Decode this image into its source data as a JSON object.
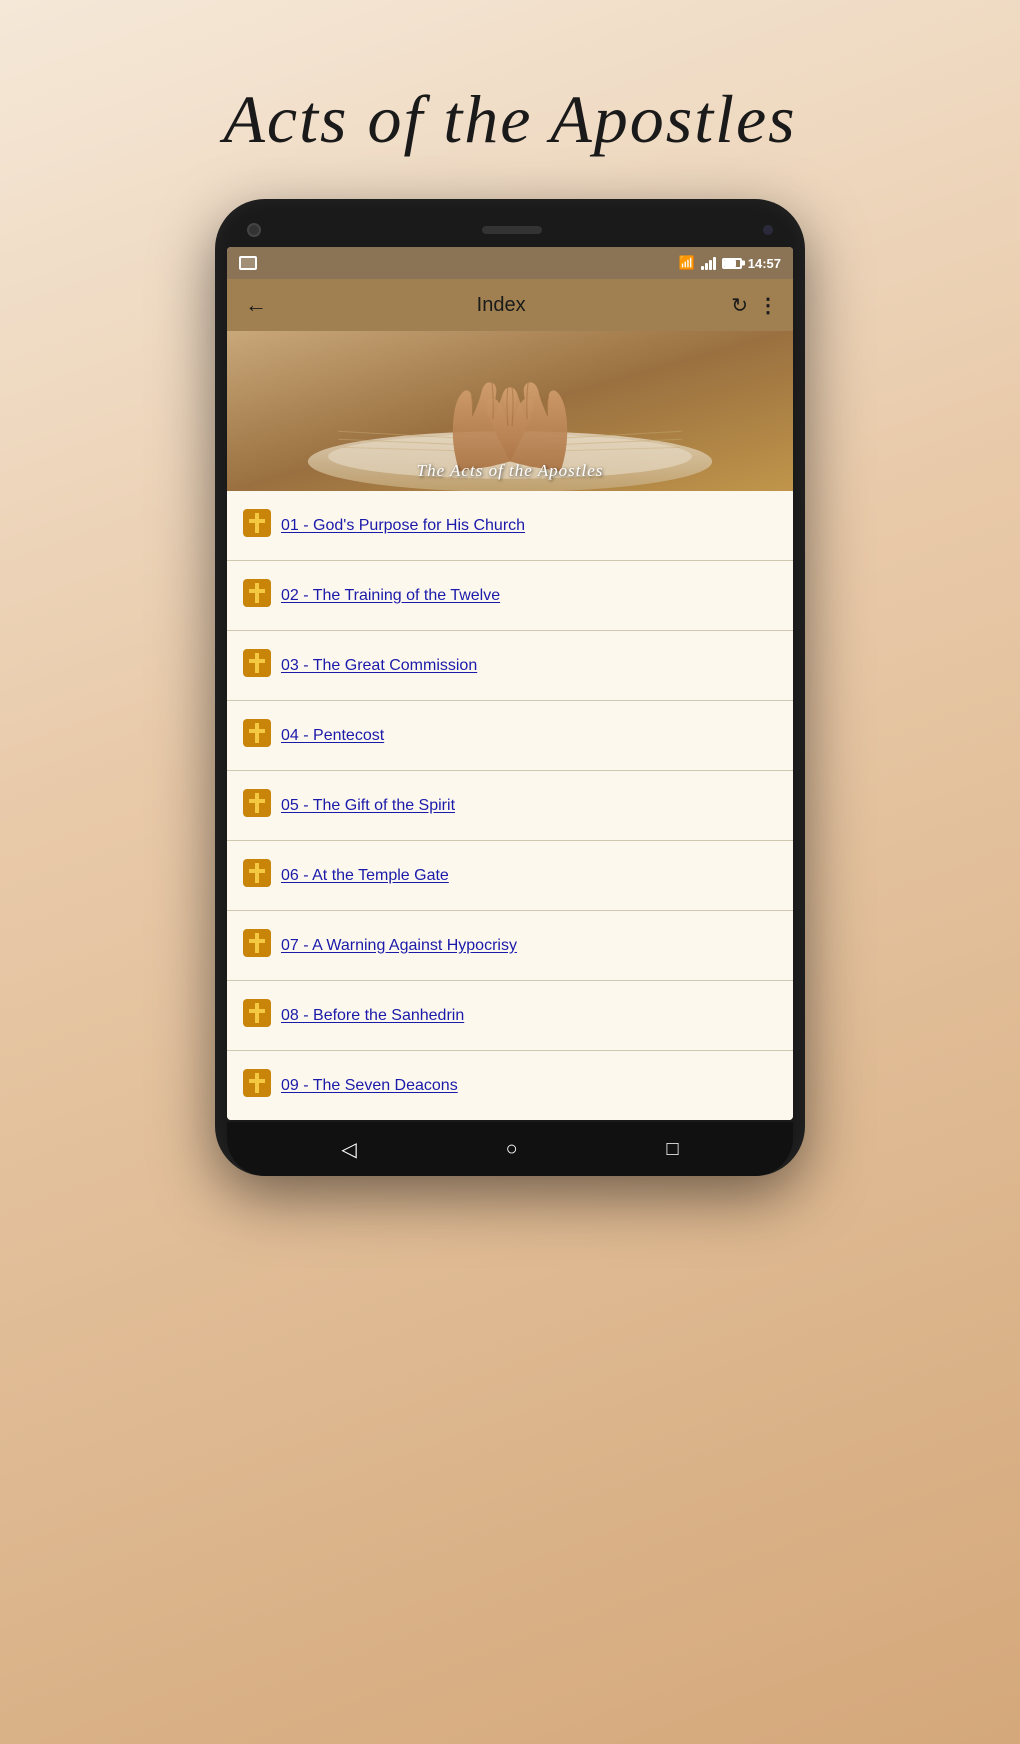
{
  "page": {
    "title": "Acts of the Apostles"
  },
  "status_bar": {
    "time": "14:57"
  },
  "toolbar": {
    "back_label": "←",
    "title": "Index",
    "refresh_label": "↻",
    "menu_label": "⋮"
  },
  "hero": {
    "text": "The Acts of the Apostles"
  },
  "items": [
    {
      "number": "01",
      "label": "01 - God's Purpose for His Church"
    },
    {
      "number": "02",
      "label": "02 - The Training of the Twelve"
    },
    {
      "number": "03",
      "label": "03 - The Great Commission"
    },
    {
      "number": "04",
      "label": "04 - Pentecost"
    },
    {
      "number": "05",
      "label": "05 - The Gift of the Spirit"
    },
    {
      "number": "06",
      "label": "06 - At the Temple Gate"
    },
    {
      "number": "07",
      "label": "07 - A Warning Against Hypocrisy"
    },
    {
      "number": "08",
      "label": "08 - Before the Sanhedrin"
    },
    {
      "number": "09",
      "label": "09 - The Seven Deacons"
    }
  ],
  "nav": {
    "back": "◁",
    "home": "○",
    "recent": "□"
  }
}
